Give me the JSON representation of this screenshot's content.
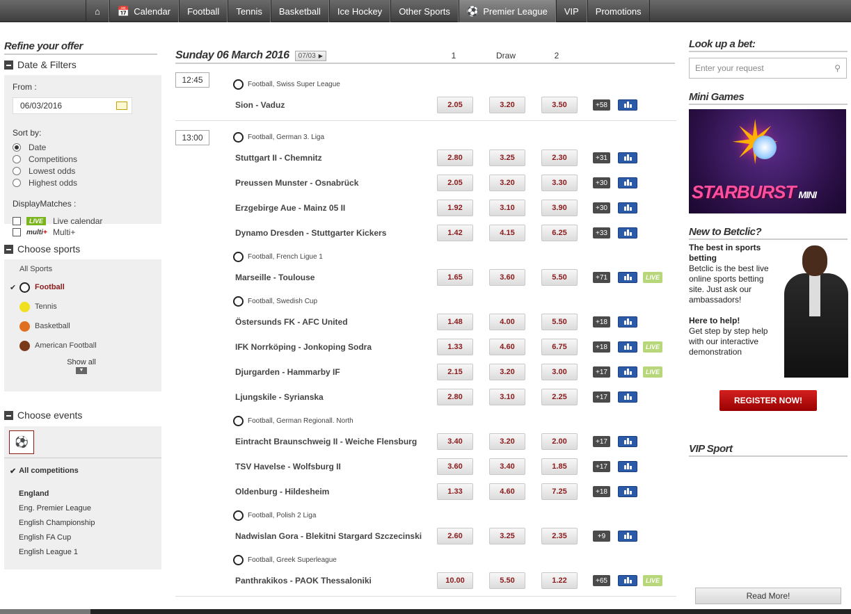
{
  "nav": {
    "items": [
      {
        "label": "Calendar",
        "icon": "calendar-icon"
      },
      {
        "label": "Football"
      },
      {
        "label": "Tennis"
      },
      {
        "label": "Basketball"
      },
      {
        "label": "Ice Hockey"
      },
      {
        "label": "Other Sports"
      },
      {
        "label": "Premier League",
        "icon": "football-icon"
      },
      {
        "label": "VIP"
      },
      {
        "label": "Promotions"
      }
    ]
  },
  "left": {
    "title": "Refine your offer",
    "date_filters": {
      "heading": "Date & Filters",
      "from_label": "From :",
      "from_value": "06/03/2016",
      "sort_label": "Sort by:",
      "sort_options": [
        "Date",
        "Competitions",
        "Lowest odds",
        "Highest odds"
      ],
      "display_label": "DisplayMatches :",
      "live_badge": "LIVE",
      "live_label": "Live calendar",
      "multi_badge": "multi",
      "multi_label": "Multi+"
    },
    "sports": {
      "heading": "Choose sports",
      "all": "All Sports",
      "items": [
        "Football",
        "Tennis",
        "Basketball",
        "American Football"
      ],
      "show_all": "Show all"
    },
    "events": {
      "heading": "Choose events",
      "all": "All competitions",
      "group": "England",
      "items": [
        "Eng. Premier League",
        "English Championship",
        "English FA Cup",
        "English League 1"
      ]
    }
  },
  "center": {
    "day_title": "Sunday 06 March 2016",
    "day_btn": "07/03",
    "col1": "1",
    "colx": "Draw",
    "col2": "2",
    "blocks": [
      {
        "time": "12:45",
        "groups": [
          {
            "comp": "Football, Swiss Super League",
            "matches": [
              {
                "name": "Sion - Vaduz",
                "o1": "2.05",
                "ox": "3.20",
                "o2": "3.50",
                "more": "+58",
                "live": false
              }
            ]
          }
        ]
      },
      {
        "time": "13:00",
        "groups": [
          {
            "comp": "Football, German 3. Liga",
            "matches": [
              {
                "name": "Stuttgart II - Chemnitz",
                "o1": "2.80",
                "ox": "3.25",
                "o2": "2.30",
                "more": "+31",
                "live": false
              },
              {
                "name": "Preussen Munster - Osnabrück",
                "o1": "2.05",
                "ox": "3.20",
                "o2": "3.30",
                "more": "+30",
                "live": false
              },
              {
                "name": "Erzgebirge Aue - Mainz 05 II",
                "o1": "1.92",
                "ox": "3.10",
                "o2": "3.90",
                "more": "+30",
                "live": false
              },
              {
                "name": "Dynamo Dresden - Stuttgarter Kickers",
                "o1": "1.42",
                "ox": "4.15",
                "o2": "6.25",
                "more": "+33",
                "live": false
              }
            ]
          },
          {
            "comp": "Football, French Ligue 1",
            "matches": [
              {
                "name": "Marseille - Toulouse",
                "o1": "1.65",
                "ox": "3.60",
                "o2": "5.50",
                "more": "+71",
                "live": true
              }
            ]
          },
          {
            "comp": "Football, Swedish Cup",
            "matches": [
              {
                "name": "Östersunds FK - AFC United",
                "o1": "1.48",
                "ox": "4.00",
                "o2": "5.50",
                "more": "+18",
                "live": false
              },
              {
                "name": "IFK Norrköping - Jonkoping Sodra",
                "o1": "1.33",
                "ox": "4.60",
                "o2": "6.75",
                "more": "+18",
                "live": true
              },
              {
                "name": "Djurgarden - Hammarby IF",
                "o1": "2.15",
                "ox": "3.20",
                "o2": "3.00",
                "more": "+17",
                "live": true
              },
              {
                "name": "Ljungskile - Syrianska",
                "o1": "2.80",
                "ox": "3.10",
                "o2": "2.25",
                "more": "+17",
                "live": false
              }
            ]
          },
          {
            "comp": "Football, German Regionall. North",
            "matches": [
              {
                "name": "Eintracht Braunschweig II - Weiche Flensburg",
                "o1": "3.40",
                "ox": "3.20",
                "o2": "2.00",
                "more": "+17",
                "live": false
              },
              {
                "name": "TSV Havelse - Wolfsburg II",
                "o1": "3.60",
                "ox": "3.40",
                "o2": "1.85",
                "more": "+17",
                "live": false
              },
              {
                "name": "Oldenburg - Hildesheim",
                "o1": "1.33",
                "ox": "4.60",
                "o2": "7.25",
                "more": "+18",
                "live": false
              }
            ]
          },
          {
            "comp": "Football, Polish 2 Liga",
            "matches": [
              {
                "name": "Nadwislan Gora - Blekitni Stargard Szczecinski",
                "o1": "2.60",
                "ox": "3.25",
                "o2": "2.35",
                "more": "+9",
                "live": false
              }
            ]
          },
          {
            "comp": "Football, Greek Superleague",
            "matches": [
              {
                "name": "Panthrakikos - PAOK Thessaloniki",
                "o1": "10.00",
                "ox": "5.50",
                "o2": "1.22",
                "more": "+65",
                "live": true
              }
            ]
          }
        ]
      }
    ]
  },
  "right": {
    "lookup_title": "Look up a bet:",
    "search_placeholder": "Enter your request",
    "mini_title": "Mini Games",
    "promo_name": "STARBURST",
    "promo_sub": "MINI",
    "new_title": "New to Betclic?",
    "new_p1_bold": "The best in sports betting",
    "new_p1": "Betclic is the best live online sports betting site. Just ask our ambassadors!",
    "new_p2_bold": "Here to help!",
    "new_p2": "Get step by step help with our interactive demonstration",
    "register": "REGISTER NOW!",
    "vip_title": "VIP Sport",
    "read_more": "Read More!"
  },
  "colors": {
    "accent": "#8b1a1a",
    "nav": "#4a4a4a",
    "stat": "#2a5aa8",
    "live": "#b7d77a",
    "register": "#c41010"
  }
}
